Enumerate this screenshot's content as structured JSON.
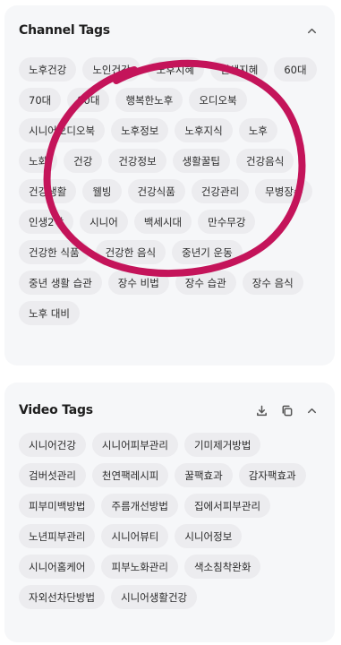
{
  "channel": {
    "title": "Channel Tags",
    "tags": [
      "노후건강",
      "노인건강",
      "노후지혜",
      "인생지혜",
      "60대",
      "70대",
      "80대",
      "행복한노후",
      "오디오북",
      "시니어오디오북",
      "노후정보",
      "노후지식",
      "노후",
      "노화",
      "건강",
      "건강정보",
      "생활꿀팁",
      "건강음식",
      "건강생활",
      "웰빙",
      "건강식품",
      "건강관리",
      "무병장수",
      "인생2막",
      "시니어",
      "백세시대",
      "만수무강",
      "건강한 식품",
      "건강한 음식",
      "중년기 운동",
      "중년 생활 습관",
      "장수 비법",
      "장수 습관",
      "장수 음식",
      "노후 대비"
    ]
  },
  "video": {
    "title": "Video Tags",
    "tags": [
      "시니어건강",
      "시니어피부관리",
      "기미제거방법",
      "검버섯관리",
      "천연팩레시피",
      "꿀팩효과",
      "감자팩효과",
      "피부미백방법",
      "주름개선방법",
      "집에서피부관리",
      "노년피부관리",
      "시니어뷰티",
      "시니어정보",
      "시니어홈케어",
      "피부노화관리",
      "색소침착완화",
      "자외선차단방법",
      "시니어생활건강"
    ]
  },
  "icons": {
    "collapse": "chevron-up-icon",
    "download": "download-icon",
    "copy": "copy-icon"
  },
  "annotation_color": "#c4145a"
}
